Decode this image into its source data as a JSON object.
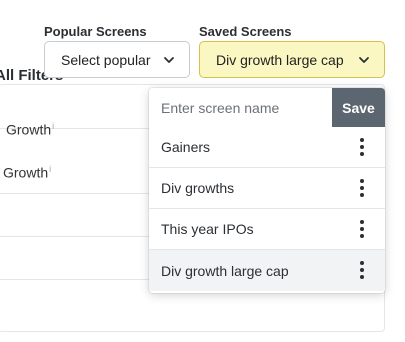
{
  "popular_screens": {
    "label": "Popular Screens",
    "selected": "Select popular"
  },
  "saved_screens": {
    "label": "Saved Screens",
    "selected": "Div growth large cap",
    "accent_bg": "#fbf7c2",
    "accent_border": "#d9c24b"
  },
  "dropdown": {
    "name_placeholder": "Enter screen name",
    "save_label": "Save",
    "items": [
      {
        "label": "Gainers"
      },
      {
        "label": "Div growths"
      },
      {
        "label": "This year IPOs"
      },
      {
        "label": "Div growth large cap"
      }
    ]
  },
  "background": {
    "title": "All Filters",
    "rows": [
      {
        "label": "Growth",
        "info": "i"
      },
      {
        "label": "Growth",
        "info": "i"
      }
    ]
  }
}
